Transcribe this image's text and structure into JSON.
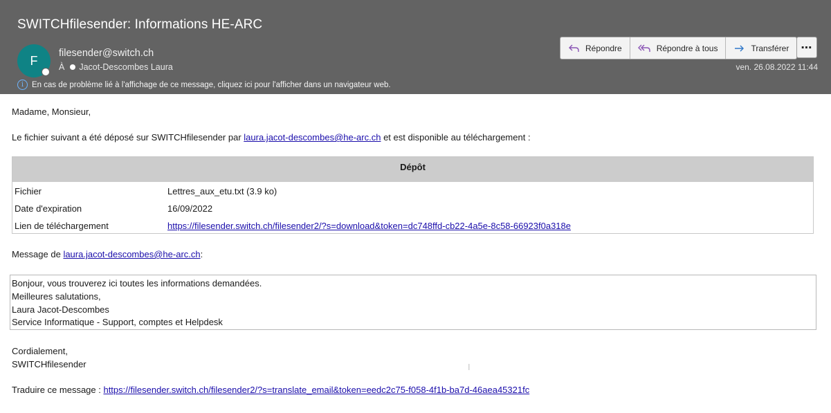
{
  "email": {
    "subject": "SWITCHfilesender: Informations HE-ARC",
    "avatar_letter": "F",
    "avatar_color": "#0f8385",
    "sender": "filesender@switch.ch",
    "to_label": "À",
    "recipient": "Jacot-Descombes Laura",
    "date": "ven. 26.08.2022 11:44",
    "info_notice": "En cas de problème lié à l'affichage de ce message, cliquez ici pour l'afficher dans un navigateur web."
  },
  "actions": {
    "reply": "Répondre",
    "reply_all": "Répondre à tous",
    "forward": "Transférer",
    "more": "⋯"
  },
  "body": {
    "greeting": "Madame, Monsieur,",
    "intro_before": "Le fichier suivant a été déposé sur SWITCHfilesender par ",
    "intro_link": "laura.jacot-descombes@he-arc.ch",
    "intro_after": " et est disponible au téléchargement :",
    "table": {
      "header": "Dépôt",
      "rows": [
        {
          "key": "Fichier",
          "value": "Lettres_aux_etu.txt (3.9 ko)"
        },
        {
          "key": "Date d'expiration",
          "value": "16/09/2022"
        },
        {
          "key": "Lien de téléchargement",
          "value": "https://filesender.switch.ch/filesender2/?s=download&token=dc748ffd-cb22-4a5e-8c58-66923f0a318e"
        }
      ]
    },
    "message_from_label": "Message de ",
    "message_from_link": "laura.jacot-descombes@he-arc.ch",
    "message_from_colon": ":",
    "message_lines": [
      "Bonjour, vous trouverez ici toutes les informations demandées.",
      "Meilleures salutations,",
      "Laura Jacot-Descombes",
      "Service Informatique - Support, comptes et Helpdesk"
    ],
    "closing": "Cordialement,",
    "signature": "SWITCHfilesender",
    "translate_label": "Traduire ce message : ",
    "translate_link": "https://filesender.switch.ch/filesender2/?s=translate_email&token=eedc2c75-f058-4f1b-ba7d-46aea45321fc"
  }
}
